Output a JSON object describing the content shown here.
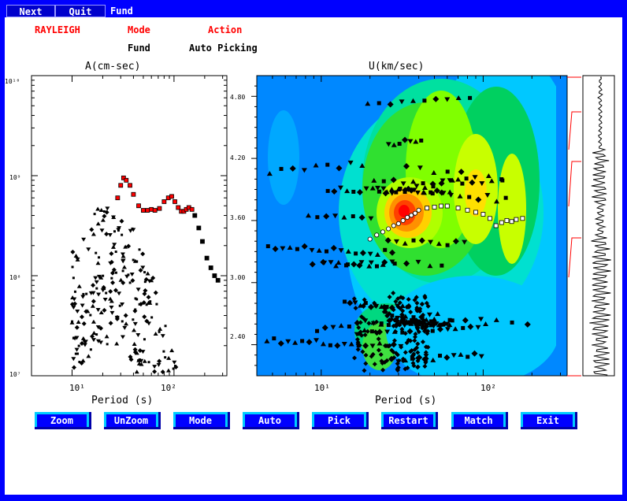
{
  "topbar": {
    "next_label": "Next",
    "quit_label": "Quit",
    "mode_label": "Fund"
  },
  "header": {
    "wave_type": "RAYLEIGH",
    "mode_heading": "Mode",
    "action_heading": "Action",
    "mode_value": "Fund",
    "action_value": "Auto Picking"
  },
  "left_plot": {
    "title": "A(cm-sec)",
    "xlabel": "Period (s)",
    "y_ticks": [
      "10¹⁰",
      "10⁹",
      "10⁸",
      "10⁷"
    ],
    "x_ticks": [
      "10¹",
      "10²"
    ]
  },
  "right_plot": {
    "title": "U(km/sec)",
    "xlabel": "Period (s)",
    "y_ticks": [
      "4.80",
      "4.20",
      "3.60",
      "3.00",
      "2.40"
    ],
    "x_ticks": [
      "10¹",
      "10²"
    ]
  },
  "buttons": [
    "Zoom",
    "UnZoom",
    "Mode",
    "Auto",
    "Pick",
    "Restart",
    "Match",
    "Exit"
  ],
  "colors": {
    "frame": "#0000ff",
    "button_face": "#0000ff",
    "button_edge": "#00ccff",
    "accent_red": "#ff0000",
    "picked_curve": "#ffffff"
  },
  "chart_data": [
    {
      "type": "scatter",
      "title": "A(cm-sec)",
      "xlabel": "Period (s)",
      "ylabel": "",
      "x_scale": "log",
      "y_scale": "log",
      "xlim": [
        4,
        330
      ],
      "ylim": [
        10000000.0,
        10000000000.0
      ],
      "series": [
        {
          "name": "",
          "x": [
            28,
            30,
            32,
            34,
            37,
            40,
            45,
            50,
            55,
            60,
            65,
            72,
            80,
            88,
            95,
            102,
            110,
            118,
            125,
            132,
            140,
            150,
            160,
            175,
            190,
            210,
            230,
            250,
            270
          ],
          "y": [
            600000000.0,
            800000000.0,
            950000000.0,
            900000000.0,
            800000000.0,
            650000000.0,
            500000000.0,
            450000000.0,
            450000000.0,
            460000000.0,
            450000000.0,
            470000000.0,
            550000000.0,
            600000000.0,
            620000000.0,
            550000000.0,
            480000000.0,
            440000000.0,
            440000000.0,
            460000000.0,
            480000000.0,
            460000000.0,
            400000000.0,
            300000000.0,
            220000000.0,
            150000000.0,
            120000000.0,
            100000000.0,
            90000000.0
          ]
        }
      ]
    },
    {
      "type": "heatmap",
      "title": "U(km/sec)",
      "xlabel": "Period (s)",
      "ylabel": "",
      "x_scale": "log",
      "xlim": [
        4,
        330
      ],
      "ylim": [
        2.1,
        5.0
      ],
      "series": [
        {
          "name": "",
          "x": [
            20,
            22,
            24,
            26,
            28,
            30,
            32,
            34,
            36,
            38,
            40,
            45,
            50,
            55,
            60,
            70,
            80,
            90,
            100,
            110,
            120,
            130,
            140,
            150,
            160,
            175
          ],
          "y": [
            3.42,
            3.46,
            3.49,
            3.52,
            3.55,
            3.57,
            3.6,
            3.63,
            3.65,
            3.67,
            3.7,
            3.72,
            3.73,
            3.74,
            3.74,
            3.72,
            3.7,
            3.68,
            3.66,
            3.62,
            3.55,
            3.58,
            3.6,
            3.59,
            3.61,
            3.62
          ]
        }
      ]
    }
  ]
}
